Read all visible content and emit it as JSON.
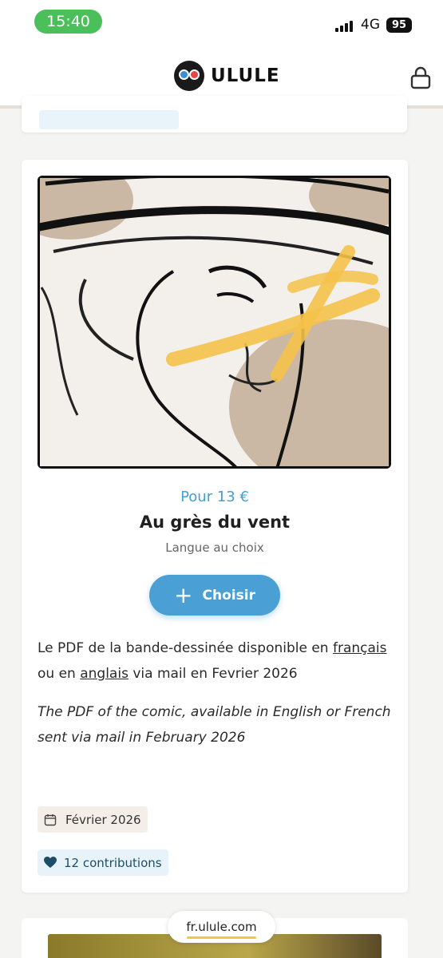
{
  "status_bar": {
    "time": "15:40",
    "network": "4G",
    "battery": "95"
  },
  "header": {
    "logo_text": "ULULE",
    "lock_icon": "lock-icon"
  },
  "reward": {
    "price": "Pour 13 €",
    "title": "Au grès du vent",
    "subtitle": "Langue au choix",
    "choose_label": "Choisir",
    "description_fr": {
      "part1": "Le PDF de la bande-dessinée disponible en ",
      "link1": "français",
      "part2": " ou en ",
      "link2": "anglais",
      "part3": " via mail en Fevrier 2026"
    },
    "description_en": "The PDF of the comic, available in English or French sent via mail in February 2026",
    "delivery_date": "Février 2026",
    "contributions": "12 contributions"
  },
  "browser": {
    "url": "fr.ulule.com"
  },
  "colors": {
    "accent_blue": "#4a9fd4",
    "price_blue": "#3fa0d2",
    "time_green": "#4bbf5a",
    "highlight_yellow": "#f5c24a"
  }
}
